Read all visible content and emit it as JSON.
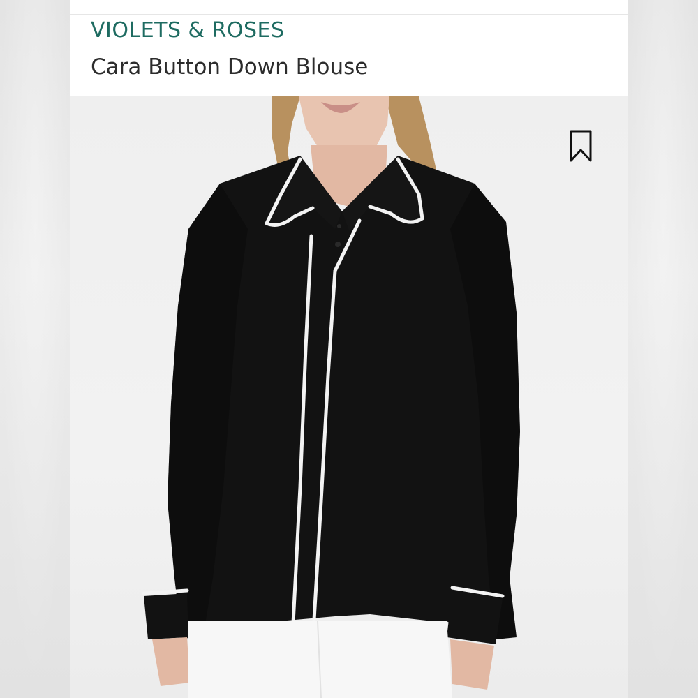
{
  "listing": {
    "brand": "VIOLETS & ROSES",
    "title": "Cara Button Down Blouse"
  },
  "image": {
    "icons": [
      "bookmark-icon"
    ]
  },
  "colors": {
    "brand_text": "#1e6b61",
    "title_text": "#2c2c2c",
    "blouse": "#111111",
    "piping": "#f3f3f3",
    "background": "#f1f1f1"
  }
}
